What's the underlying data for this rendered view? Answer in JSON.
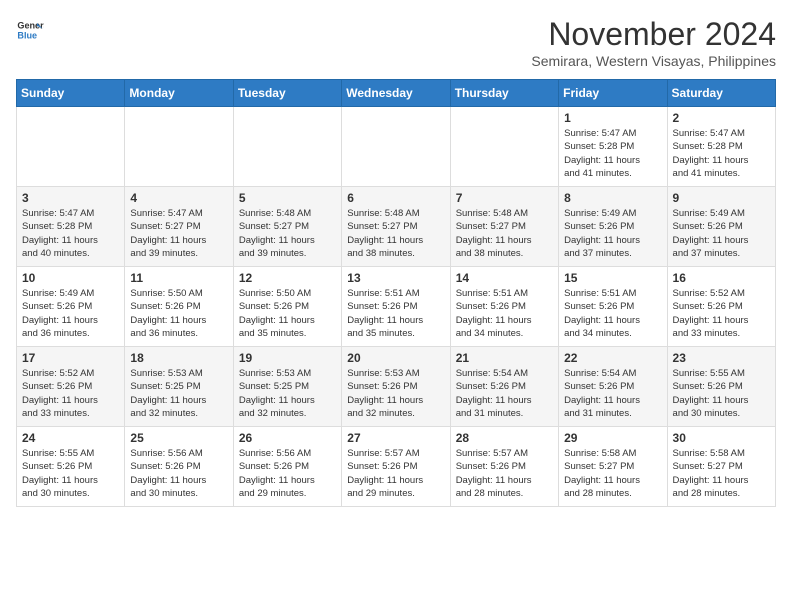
{
  "header": {
    "logo_line1": "General",
    "logo_line2": "Blue",
    "month_year": "November 2024",
    "location": "Semirara, Western Visayas, Philippines"
  },
  "weekdays": [
    "Sunday",
    "Monday",
    "Tuesday",
    "Wednesday",
    "Thursday",
    "Friday",
    "Saturday"
  ],
  "weeks": [
    [
      {
        "day": "",
        "info": ""
      },
      {
        "day": "",
        "info": ""
      },
      {
        "day": "",
        "info": ""
      },
      {
        "day": "",
        "info": ""
      },
      {
        "day": "",
        "info": ""
      },
      {
        "day": "1",
        "info": "Sunrise: 5:47 AM\nSunset: 5:28 PM\nDaylight: 11 hours\nand 41 minutes."
      },
      {
        "day": "2",
        "info": "Sunrise: 5:47 AM\nSunset: 5:28 PM\nDaylight: 11 hours\nand 41 minutes."
      }
    ],
    [
      {
        "day": "3",
        "info": "Sunrise: 5:47 AM\nSunset: 5:28 PM\nDaylight: 11 hours\nand 40 minutes."
      },
      {
        "day": "4",
        "info": "Sunrise: 5:47 AM\nSunset: 5:27 PM\nDaylight: 11 hours\nand 39 minutes."
      },
      {
        "day": "5",
        "info": "Sunrise: 5:48 AM\nSunset: 5:27 PM\nDaylight: 11 hours\nand 39 minutes."
      },
      {
        "day": "6",
        "info": "Sunrise: 5:48 AM\nSunset: 5:27 PM\nDaylight: 11 hours\nand 38 minutes."
      },
      {
        "day": "7",
        "info": "Sunrise: 5:48 AM\nSunset: 5:27 PM\nDaylight: 11 hours\nand 38 minutes."
      },
      {
        "day": "8",
        "info": "Sunrise: 5:49 AM\nSunset: 5:26 PM\nDaylight: 11 hours\nand 37 minutes."
      },
      {
        "day": "9",
        "info": "Sunrise: 5:49 AM\nSunset: 5:26 PM\nDaylight: 11 hours\nand 37 minutes."
      }
    ],
    [
      {
        "day": "10",
        "info": "Sunrise: 5:49 AM\nSunset: 5:26 PM\nDaylight: 11 hours\nand 36 minutes."
      },
      {
        "day": "11",
        "info": "Sunrise: 5:50 AM\nSunset: 5:26 PM\nDaylight: 11 hours\nand 36 minutes."
      },
      {
        "day": "12",
        "info": "Sunrise: 5:50 AM\nSunset: 5:26 PM\nDaylight: 11 hours\nand 35 minutes."
      },
      {
        "day": "13",
        "info": "Sunrise: 5:51 AM\nSunset: 5:26 PM\nDaylight: 11 hours\nand 35 minutes."
      },
      {
        "day": "14",
        "info": "Sunrise: 5:51 AM\nSunset: 5:26 PM\nDaylight: 11 hours\nand 34 minutes."
      },
      {
        "day": "15",
        "info": "Sunrise: 5:51 AM\nSunset: 5:26 PM\nDaylight: 11 hours\nand 34 minutes."
      },
      {
        "day": "16",
        "info": "Sunrise: 5:52 AM\nSunset: 5:26 PM\nDaylight: 11 hours\nand 33 minutes."
      }
    ],
    [
      {
        "day": "17",
        "info": "Sunrise: 5:52 AM\nSunset: 5:26 PM\nDaylight: 11 hours\nand 33 minutes."
      },
      {
        "day": "18",
        "info": "Sunrise: 5:53 AM\nSunset: 5:25 PM\nDaylight: 11 hours\nand 32 minutes."
      },
      {
        "day": "19",
        "info": "Sunrise: 5:53 AM\nSunset: 5:25 PM\nDaylight: 11 hours\nand 32 minutes."
      },
      {
        "day": "20",
        "info": "Sunrise: 5:53 AM\nSunset: 5:26 PM\nDaylight: 11 hours\nand 32 minutes."
      },
      {
        "day": "21",
        "info": "Sunrise: 5:54 AM\nSunset: 5:26 PM\nDaylight: 11 hours\nand 31 minutes."
      },
      {
        "day": "22",
        "info": "Sunrise: 5:54 AM\nSunset: 5:26 PM\nDaylight: 11 hours\nand 31 minutes."
      },
      {
        "day": "23",
        "info": "Sunrise: 5:55 AM\nSunset: 5:26 PM\nDaylight: 11 hours\nand 30 minutes."
      }
    ],
    [
      {
        "day": "24",
        "info": "Sunrise: 5:55 AM\nSunset: 5:26 PM\nDaylight: 11 hours\nand 30 minutes."
      },
      {
        "day": "25",
        "info": "Sunrise: 5:56 AM\nSunset: 5:26 PM\nDaylight: 11 hours\nand 30 minutes."
      },
      {
        "day": "26",
        "info": "Sunrise: 5:56 AM\nSunset: 5:26 PM\nDaylight: 11 hours\nand 29 minutes."
      },
      {
        "day": "27",
        "info": "Sunrise: 5:57 AM\nSunset: 5:26 PM\nDaylight: 11 hours\nand 29 minutes."
      },
      {
        "day": "28",
        "info": "Sunrise: 5:57 AM\nSunset: 5:26 PM\nDaylight: 11 hours\nand 28 minutes."
      },
      {
        "day": "29",
        "info": "Sunrise: 5:58 AM\nSunset: 5:27 PM\nDaylight: 11 hours\nand 28 minutes."
      },
      {
        "day": "30",
        "info": "Sunrise: 5:58 AM\nSunset: 5:27 PM\nDaylight: 11 hours\nand 28 minutes."
      }
    ]
  ]
}
